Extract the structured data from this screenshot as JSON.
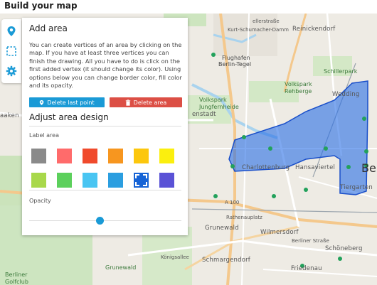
{
  "page": {
    "title": "Build your map"
  },
  "tabs": [
    {
      "icon": "map-marker-icon",
      "active": true
    },
    {
      "icon": "selection-area-icon",
      "active": false
    },
    {
      "icon": "gear-icon",
      "active": false
    }
  ],
  "panel": {
    "title": "Add area",
    "description": "You can create vertices of an area by clicking on the map. If you have at least three vertices you can finish the drawing. All you have to do is click on the first added vertex (it should change its color). Using options below you can change border color, fill color and its opacity.",
    "delete_last_label": "Delete last point",
    "delete_area_label": "Delete area",
    "design_title": "Adjust area design",
    "label_area": "Label area",
    "opacity_label": "Opacity",
    "opacity_value": 0.5,
    "colors": [
      "#8a8a8a",
      "#ff6b6b",
      "#f04a2c",
      "#f7961f",
      "#fcc70d",
      "#fbef0e",
      "#a8d84a",
      "#5cd05c",
      "#49c5f2",
      "#2b9ee0",
      "#1563d6",
      "#5a52d6"
    ],
    "selected_color": "#1563d6",
    "icons": {
      "delete_last": "map-marker-icon",
      "delete_area": "trash-icon"
    }
  },
  "map": {
    "labels": [
      {
        "text": "Reinickendorf",
        "cls": "district"
      },
      {
        "text": "Flughafen",
        "cls": ""
      },
      {
        "text": "Berlin-Tegel",
        "cls": ""
      },
      {
        "text": "Schillerpark",
        "cls": "green"
      },
      {
        "text": "Volkspark",
        "cls": "green"
      },
      {
        "text": "Rehberge",
        "cls": "green"
      },
      {
        "text": "Volkspark",
        "cls": "green"
      },
      {
        "text": "Jungfernheide",
        "cls": "green"
      },
      {
        "text": "Wedding",
        "cls": "district"
      },
      {
        "text": "enstadt",
        "cls": "district"
      },
      {
        "text": "Charlottenburg",
        "cls": "district"
      },
      {
        "text": "Hansaviertel",
        "cls": "district"
      },
      {
        "text": "Tiergarten",
        "cls": "district"
      },
      {
        "text": "Be",
        "cls": "huge"
      },
      {
        "text": "Grunewald",
        "cls": "district"
      },
      {
        "text": "Wilmersdorf",
        "cls": "district"
      },
      {
        "text": "Berliner Straße",
        "cls": "road"
      },
      {
        "text": "Schöneberg",
        "cls": "district"
      },
      {
        "text": "Schmargendorf",
        "cls": "district"
      },
      {
        "text": "Friedenau",
        "cls": "district"
      },
      {
        "text": "aaken",
        "cls": "district"
      },
      {
        "text": "Grunewald",
        "cls": "green"
      },
      {
        "text": "Berliner",
        "cls": "green"
      },
      {
        "text": "Golfclub",
        "cls": "green"
      },
      {
        "text": "Kurt-Schumacher-Damm",
        "cls": "road"
      },
      {
        "text": "Königsallee",
        "cls": "road"
      },
      {
        "text": "Rathenauplatz",
        "cls": "road"
      },
      {
        "text": "ellerstraße",
        "cls": "road"
      },
      {
        "text": "A 100",
        "cls": "road"
      }
    ]
  }
}
